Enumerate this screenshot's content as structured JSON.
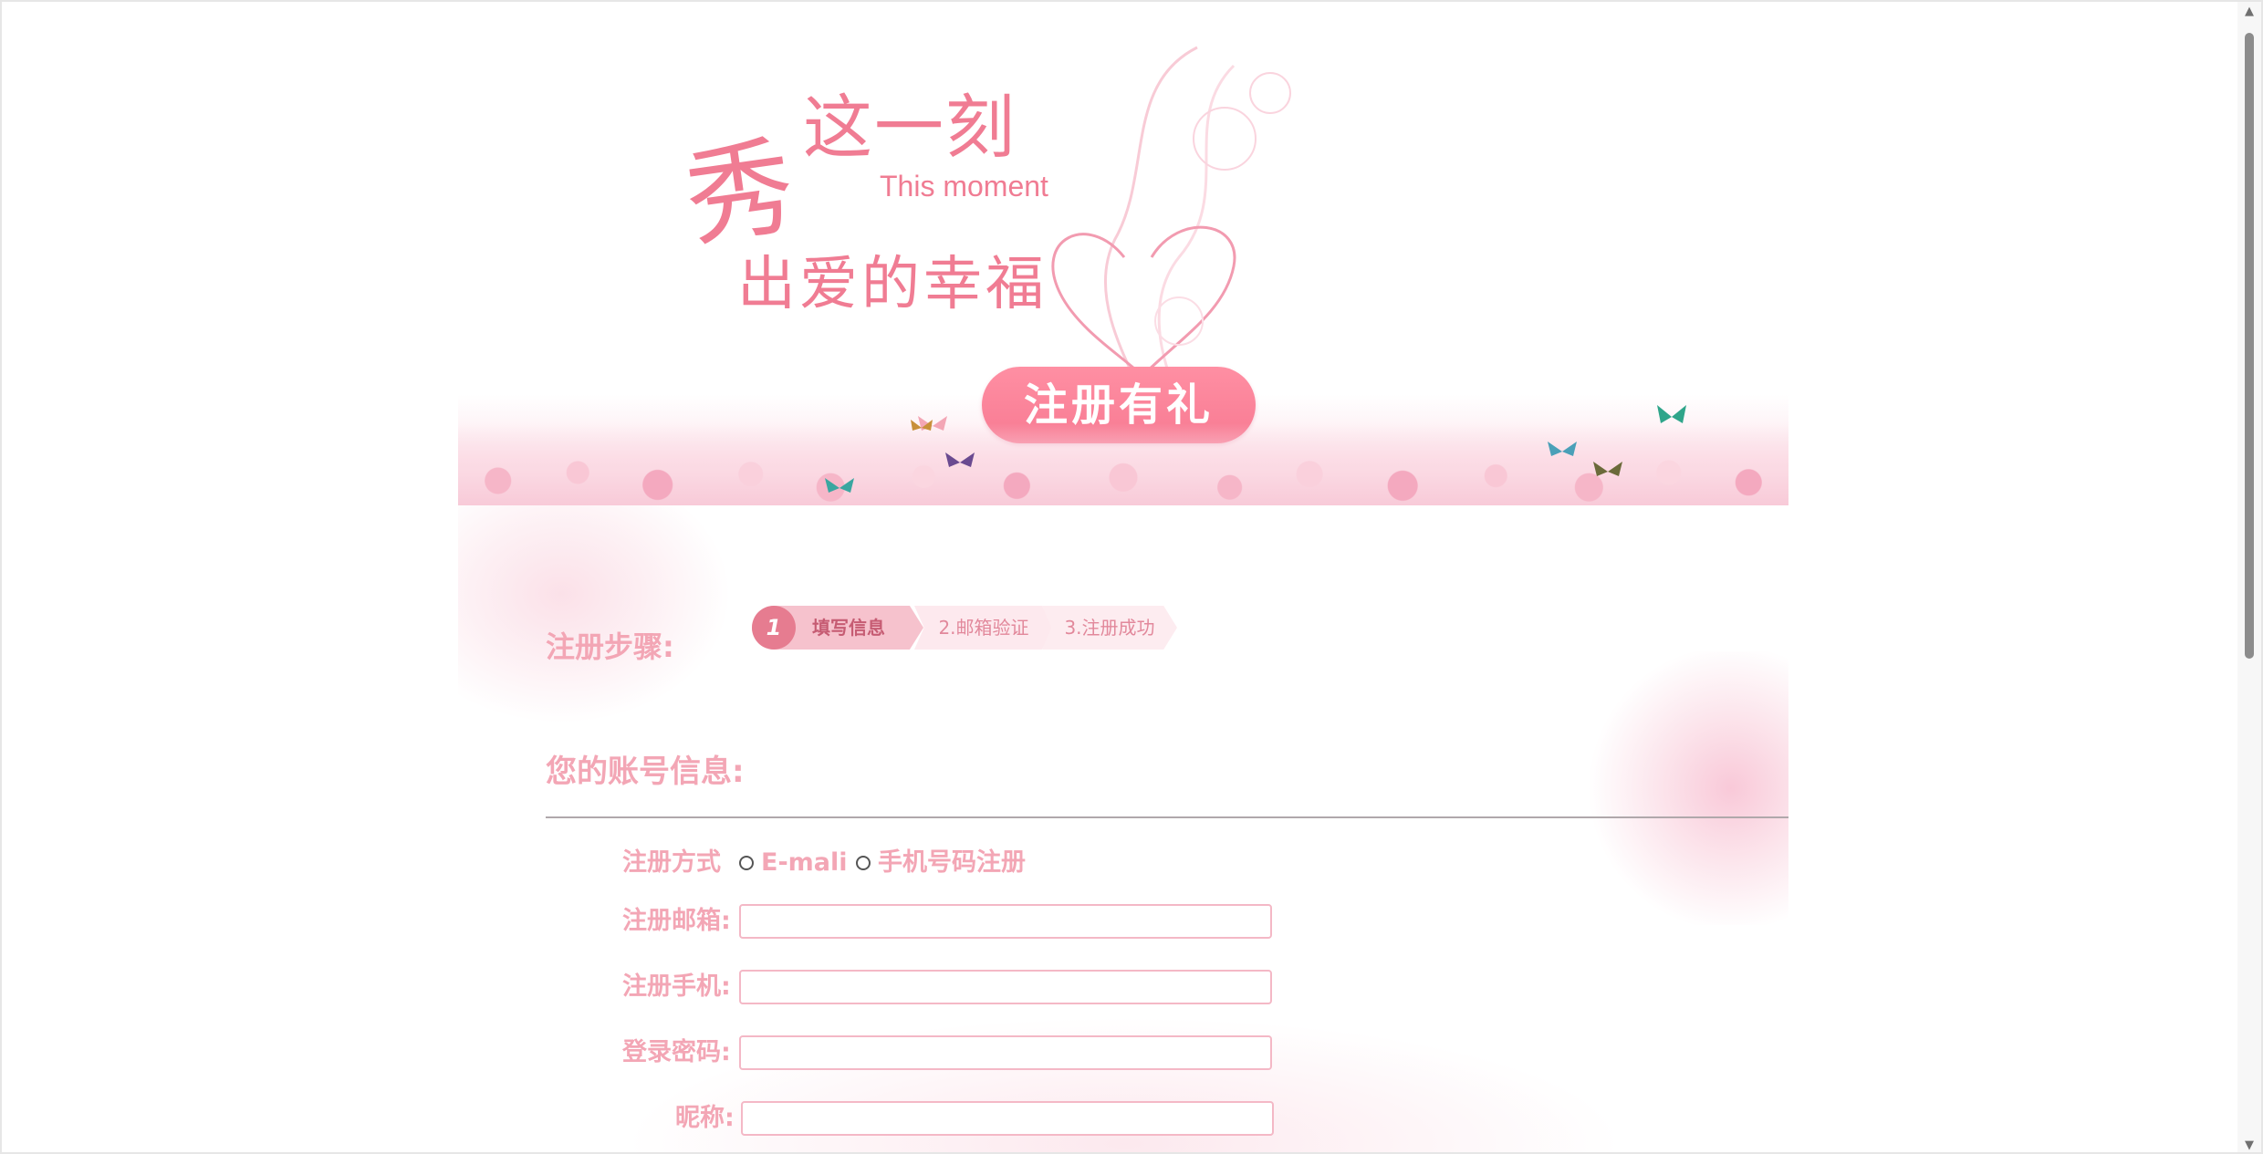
{
  "banner": {
    "slogan_big": "秀",
    "slogan_line1": "这一刻",
    "slogan_english": "This moment",
    "slogan_line2": "出爱的幸福",
    "cta_label": "注册有礼"
  },
  "steps": {
    "title": "注册步骤:",
    "items": [
      {
        "number": "1",
        "label": "填写信息",
        "active": true
      },
      {
        "label": "2.邮箱验证",
        "active": false
      },
      {
        "label": "3.注册成功",
        "active": false
      }
    ]
  },
  "account": {
    "title": "您的账号信息:"
  },
  "form": {
    "method_label": "注册方式",
    "method_options": [
      "E-mali",
      "手机号码注册"
    ],
    "email_label": "注册邮箱:",
    "email_value": "",
    "phone_label": "注册手机:",
    "phone_value": "",
    "password_label": "登录密码:",
    "password_value": "",
    "nickname_label": "昵称:",
    "nickname_value": ""
  },
  "colors": {
    "accent_pink": "#f3a6b5",
    "cta_pink": "#f77a92",
    "step_active": "#e67c90"
  }
}
